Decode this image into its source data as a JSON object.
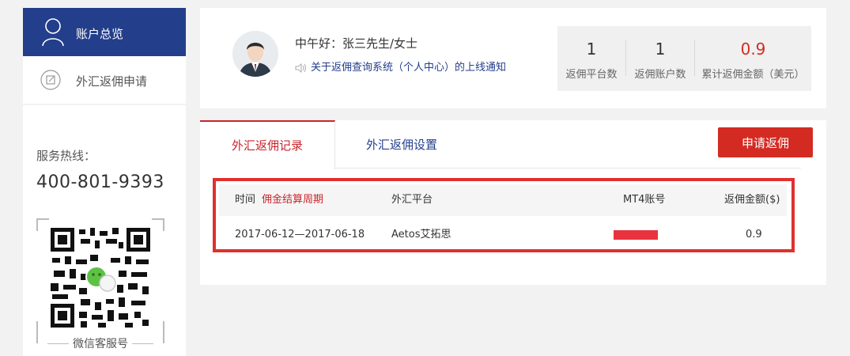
{
  "sidebar": {
    "nav_active_label": "账户总览",
    "nav_item_label": "外汇返佣申请",
    "hotline_label": "服务热线：",
    "hotline_number": "400-801-9393",
    "qr_caption": "微信客服号"
  },
  "profile": {
    "greeting": "中午好：张三先生/女士",
    "notice": "关于返佣查询系统（个人中心）的上线通知"
  },
  "stats": [
    {
      "value": "1",
      "label": "返佣平台数"
    },
    {
      "value": "1",
      "label": "返佣账户数"
    },
    {
      "value": "0.9",
      "label": "累计返佣金额（美元）"
    }
  ],
  "tabs": {
    "records": "外汇返佣记录",
    "settings": "外汇返佣设置"
  },
  "apply_button": "申请返佣",
  "table": {
    "headers": {
      "time": "时间",
      "period": "佣金结算周期",
      "platform": "外汇平台",
      "account": "MT4账号",
      "amount": "返佣金额($)"
    },
    "rows": [
      {
        "time": "2017-06-12—2017-06-18",
        "platform": "Aetos艾拓思",
        "amount": "0.9"
      }
    ]
  },
  "colors": {
    "primary": "#233e8b",
    "accent": "#d32b22",
    "highlight": "#e0302f"
  }
}
